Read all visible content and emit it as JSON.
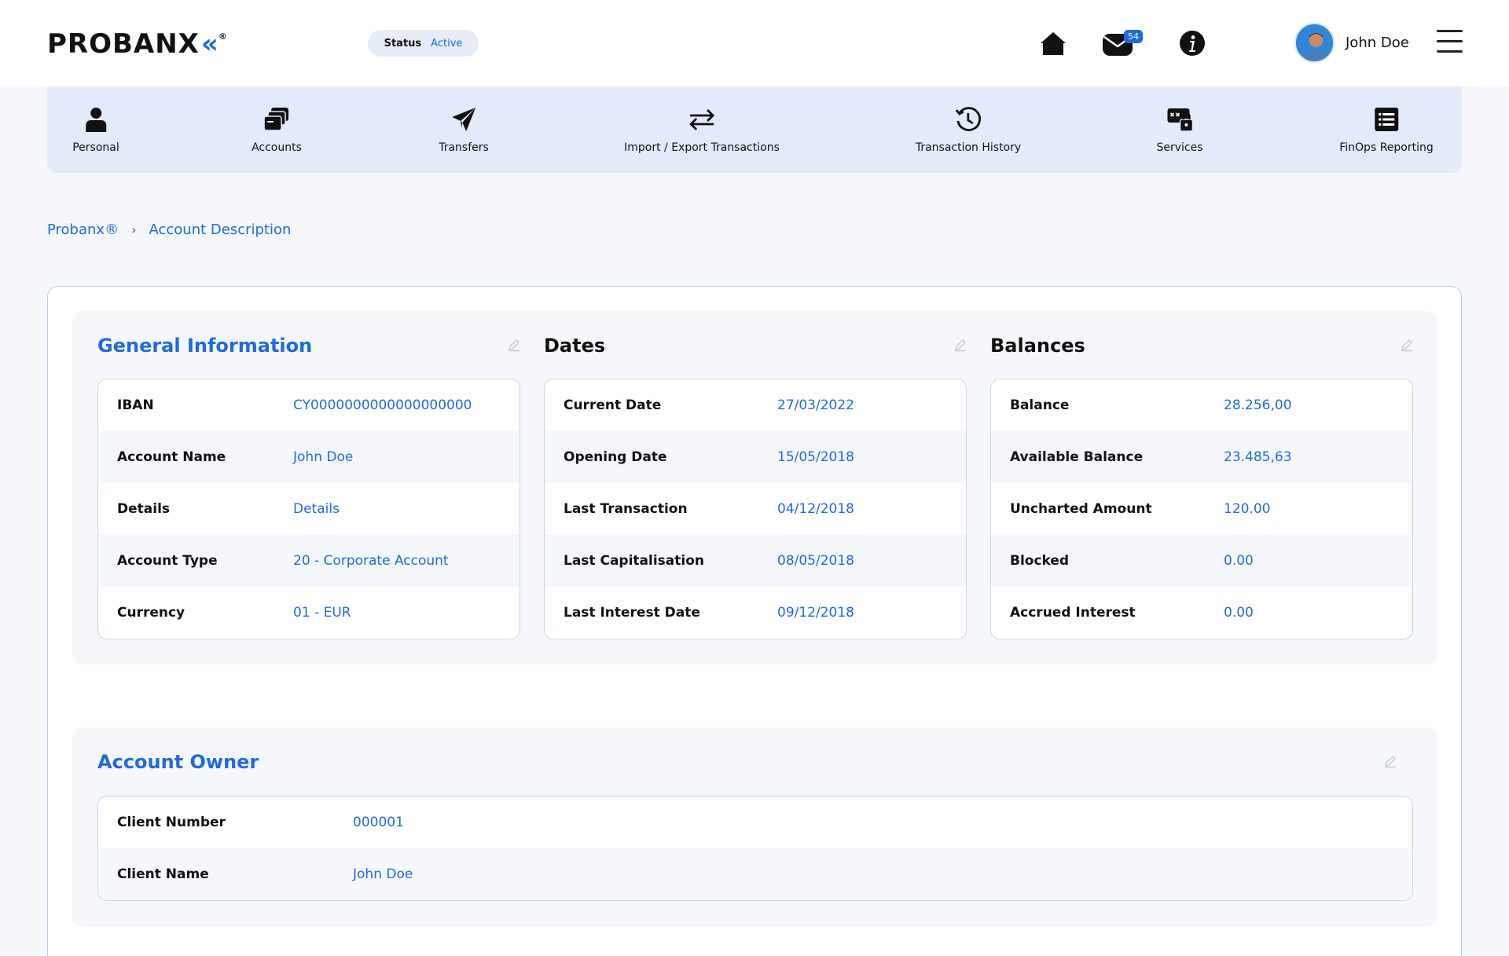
{
  "header": {
    "logo_text": "PROBANX",
    "logo_mark": "«",
    "logo_reg": "®",
    "status_label": "Status",
    "status_value": "Active",
    "messages_badge": "54",
    "user_name": "John Doe",
    "icons": [
      "home-icon",
      "mail-icon",
      "info-icon",
      "menu-icon"
    ]
  },
  "nav": {
    "items": [
      {
        "label": "Personal",
        "icon": "person-icon"
      },
      {
        "label": "Accounts",
        "icon": "accounts-icon"
      },
      {
        "label": "Transfers",
        "icon": "paper-plane-icon"
      },
      {
        "label": "Import / Export Transactions",
        "icon": "swap-arrows-icon"
      },
      {
        "label": "Transaction History",
        "icon": "history-icon"
      },
      {
        "label": "Services",
        "icon": "services-lock-icon"
      },
      {
        "label": "FinOps Reporting",
        "icon": "list-report-icon"
      }
    ]
  },
  "breadcrumb": {
    "root": "Probanx®",
    "current": "Account Description"
  },
  "general": {
    "title": "General Information",
    "rows": [
      {
        "key": "IBAN",
        "value": "CY0000000000000000000"
      },
      {
        "key": "Account Name",
        "value": "John Doe"
      },
      {
        "key": "Details",
        "value": "Details"
      },
      {
        "key": "Account Type",
        "value": "20 - Corporate Account"
      },
      {
        "key": "Currency",
        "value": "01 - EUR"
      }
    ]
  },
  "dates": {
    "title": "Dates",
    "rows": [
      {
        "key": "Current Date",
        "value": "27/03/2022"
      },
      {
        "key": "Opening Date",
        "value": "15/05/2018"
      },
      {
        "key": "Last Transaction",
        "value": "04/12/2018"
      },
      {
        "key": "Last Capitalisation",
        "value": "08/05/2018"
      },
      {
        "key": "Last Interest Date",
        "value": "09/12/2018"
      }
    ]
  },
  "balances": {
    "title": "Balances",
    "rows": [
      {
        "key": "Balance",
        "value": "28.256,00"
      },
      {
        "key": "Available Balance",
        "value": "23.485,63"
      },
      {
        "key": "Uncharted Amount",
        "value": "120.00"
      },
      {
        "key": "Blocked",
        "value": "0.00"
      },
      {
        "key": "Accrued Interest",
        "value": "0.00"
      }
    ]
  },
  "owner": {
    "title": "Account Owner",
    "rows": [
      {
        "key": "Client Number",
        "value": "000001"
      },
      {
        "key": "Client Name",
        "value": "John Doe"
      }
    ]
  },
  "colors": {
    "accent": "#1e6be0",
    "nav_bg": "#e3ebfb",
    "page_bg": "#f6f7fb"
  }
}
